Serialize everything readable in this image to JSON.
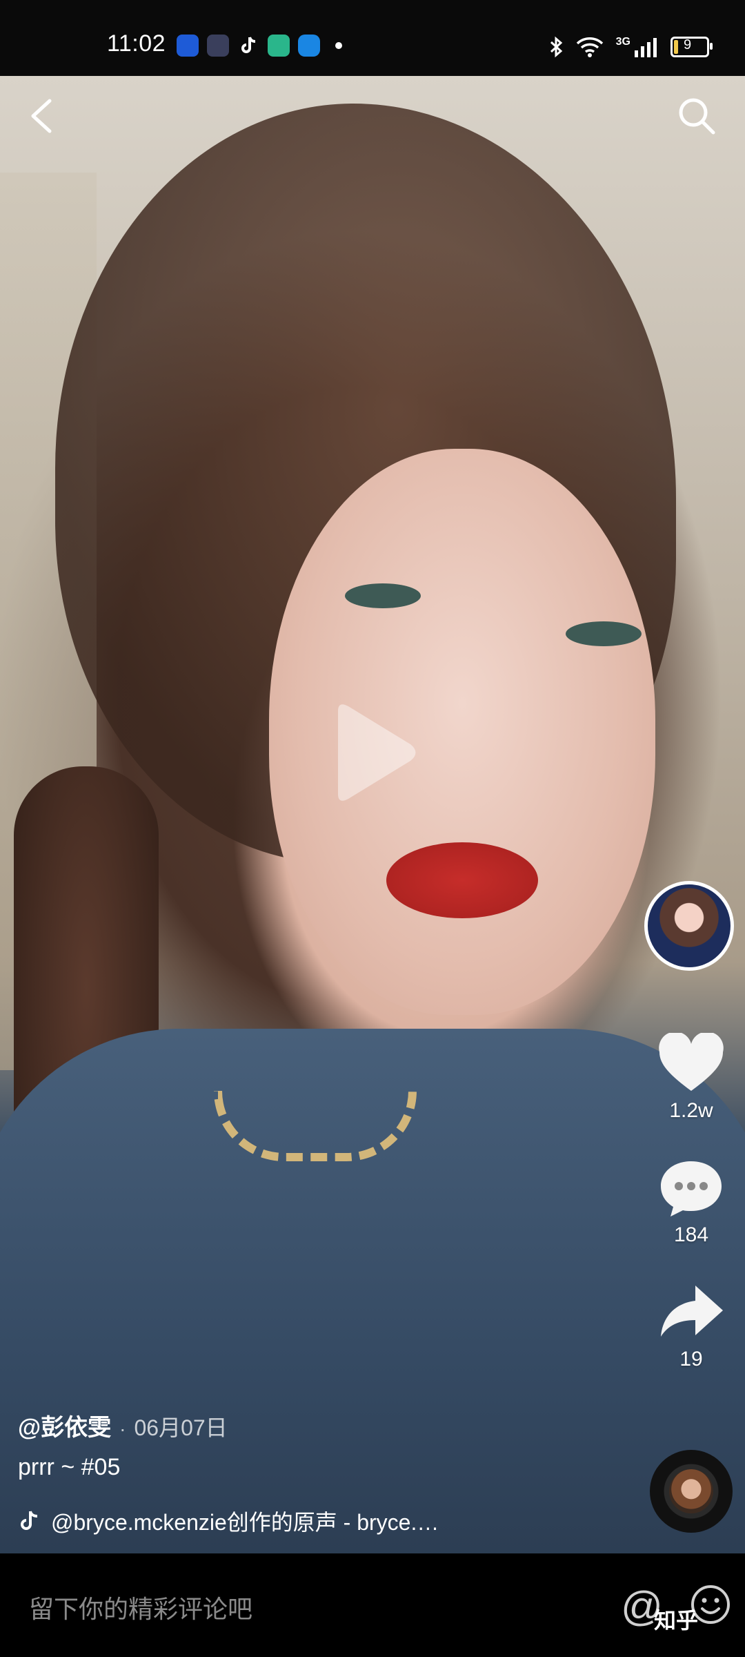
{
  "status_bar": {
    "time": "11:02",
    "network": "3G",
    "battery": "9"
  },
  "video": {
    "author": "@彭依雯",
    "separator": "·",
    "date": "06月07日",
    "description": "prrr ~ #05",
    "music": "@bryce.mckenzie创作的原声 - bryce.…"
  },
  "actions": {
    "likes": "1.2w",
    "comments": "184",
    "shares": "19"
  },
  "comment_bar": {
    "placeholder": "留下你的精彩评论吧",
    "at_symbol": "@"
  },
  "watermark": "知乎",
  "colors": {
    "status_bg": "#0a0a0a",
    "comment_bar_bg": "#000000",
    "placeholder_text": "#8a8a8a",
    "battery_accent": "#f2c94c"
  },
  "icons": [
    "back-icon",
    "search-icon",
    "play-icon",
    "heart-icon",
    "comment-bubble-icon",
    "share-arrow-icon",
    "music-note-icon",
    "emoji-icon",
    "at-icon"
  ]
}
